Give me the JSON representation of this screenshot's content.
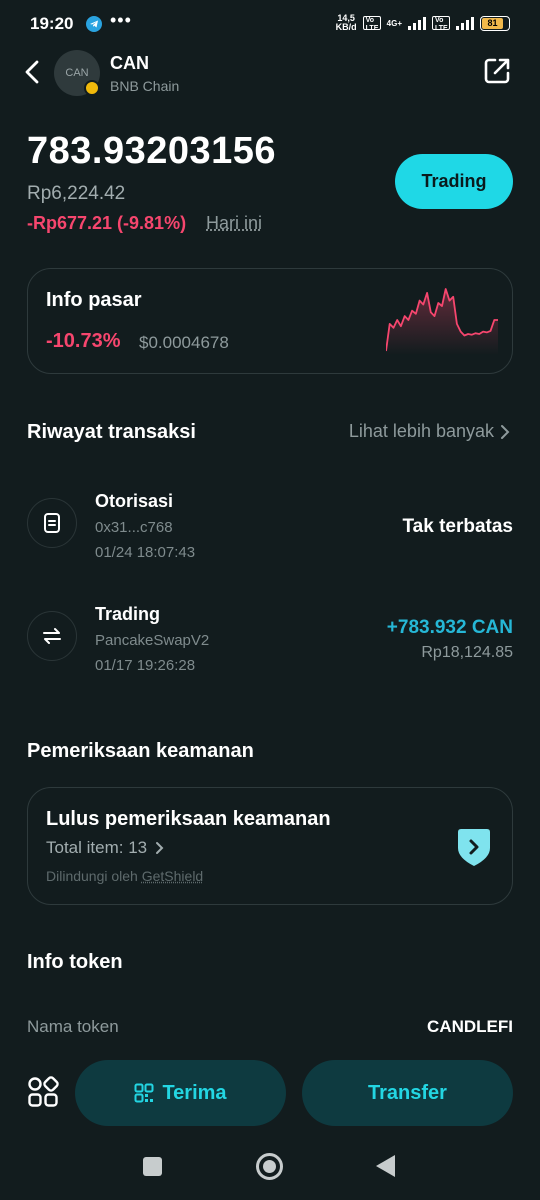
{
  "status_bar": {
    "time": "19:20",
    "net_speed_value": "14,5",
    "net_speed_unit": "KB/d",
    "volte1": "Vo LTE",
    "network": "4G+",
    "volte2": "Vo LTE",
    "battery": "81",
    "battery_level": 0.81
  },
  "header": {
    "avatar_text": "CAN",
    "symbol": "CAN",
    "chain": "BNB Chain"
  },
  "balance": {
    "amount": "783.93203156",
    "fiat": "Rp6,224.42",
    "change": "-Rp677.21 (-9.81%)",
    "period": "Hari ini",
    "trading_button": "Trading"
  },
  "market": {
    "title": "Info pasar",
    "change": "-10.73%",
    "price": "$0.0004678",
    "sparkline_color": "#f6466e",
    "sparkline_values": [
      0.1,
      0.45,
      0.4,
      0.5,
      0.42,
      0.55,
      0.5,
      0.62,
      0.58,
      0.75,
      0.7,
      0.85,
      0.6,
      0.55,
      0.72,
      0.68,
      0.9,
      0.75,
      0.8,
      0.45,
      0.35,
      0.3,
      0.32,
      0.31,
      0.33,
      0.32,
      0.35,
      0.34,
      0.36,
      0.5,
      0.5
    ]
  },
  "history": {
    "title": "Riwayat transaksi",
    "see_more": "Lihat lebih banyak",
    "items": [
      {
        "title": "Otorisasi",
        "address": "0x31...c768",
        "datetime": "01/24 18:07:43",
        "amount": "Tak terbatas",
        "fiat": "",
        "icon": "document-icon"
      },
      {
        "title": "Trading",
        "address": "PancakeSwapV2",
        "datetime": "01/17 19:26:28",
        "amount": "+783.932 CAN",
        "fiat": "Rp18,124.85",
        "icon": "swap-icon"
      }
    ]
  },
  "security": {
    "title": "Pemeriksaan keamanan",
    "card_title": "Lulus pemeriksaan keamanan",
    "total_items": "Total item: 13",
    "protected_by": "Dilindungi oleh",
    "provider": "GetShield"
  },
  "token_info": {
    "title": "Info token",
    "name_label": "Nama token",
    "name_value": "CANDLEFI"
  },
  "actions": {
    "receive": "Terima",
    "transfer": "Transfer"
  },
  "colors": {
    "accent": "#1fd8e6",
    "negative": "#f6466e",
    "positive": "#26b7d6",
    "background": "#121c1e"
  }
}
